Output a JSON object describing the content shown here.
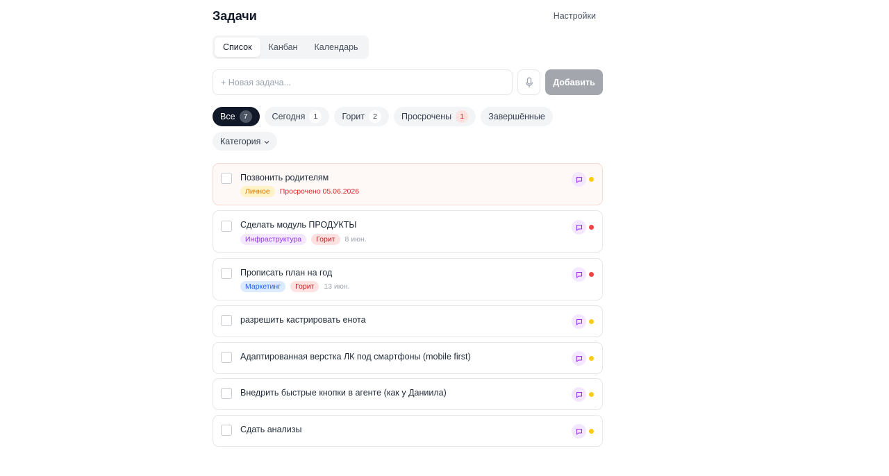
{
  "header": {
    "title": "Задачи",
    "settings_label": "Настройки"
  },
  "view_tabs": [
    {
      "label": "Список",
      "active": true
    },
    {
      "label": "Канбан",
      "active": false
    },
    {
      "label": "Календарь",
      "active": false
    }
  ],
  "new_task": {
    "placeholder": "+ Новая задача...",
    "value": "",
    "mic_icon": "microphone-icon",
    "add_label": "Добавить"
  },
  "filters": [
    {
      "label": "Все",
      "count": "7",
      "active": true
    },
    {
      "label": "Сегодня",
      "count": "1",
      "active": false
    },
    {
      "label": "Горит",
      "count": "2",
      "active": false
    },
    {
      "label": "Просрочены",
      "count": "1",
      "active": false
    },
    {
      "label": "Завершённые",
      "count": "",
      "active": false
    }
  ],
  "category_filter": {
    "label": "Категория",
    "icon": "chevron-down-icon"
  },
  "colors": {
    "urgent_dot": "#ef4444",
    "normal_dot": "#facc15",
    "overdue_text": "#dc2626",
    "comment_icon": "#9333ea",
    "accent_dark": "#111827"
  },
  "tasks": [
    {
      "title": "Позвонить родителям",
      "category": "Личное",
      "hot": "",
      "date": "Просрочено 05.06.2026",
      "overdue": true,
      "priority": "normal"
    },
    {
      "title": "Сделать модуль ПРОДУКТЫ",
      "category": "Инфраструктура",
      "hot": "Горит",
      "date": "8 июн.",
      "overdue": false,
      "priority": "urgent"
    },
    {
      "title": "Прописать план на год",
      "category": "Маркетинг",
      "hot": "Горит",
      "date": "13 июн.",
      "overdue": false,
      "priority": "urgent"
    },
    {
      "title": "разрешить кастрировать енота",
      "category": "",
      "hot": "",
      "date": "",
      "overdue": false,
      "priority": "normal"
    },
    {
      "title": "Адаптированная верстка ЛК под смартфоны (mobile first)",
      "category": "",
      "hot": "",
      "date": "",
      "overdue": false,
      "priority": "normal"
    },
    {
      "title": "Внедрить быстрые кнопки в агенте (как у Даниила)",
      "category": "",
      "hot": "",
      "date": "",
      "overdue": false,
      "priority": "normal"
    },
    {
      "title": "Сдать анализы",
      "category": "",
      "hot": "",
      "date": "",
      "overdue": false,
      "priority": "normal"
    }
  ]
}
